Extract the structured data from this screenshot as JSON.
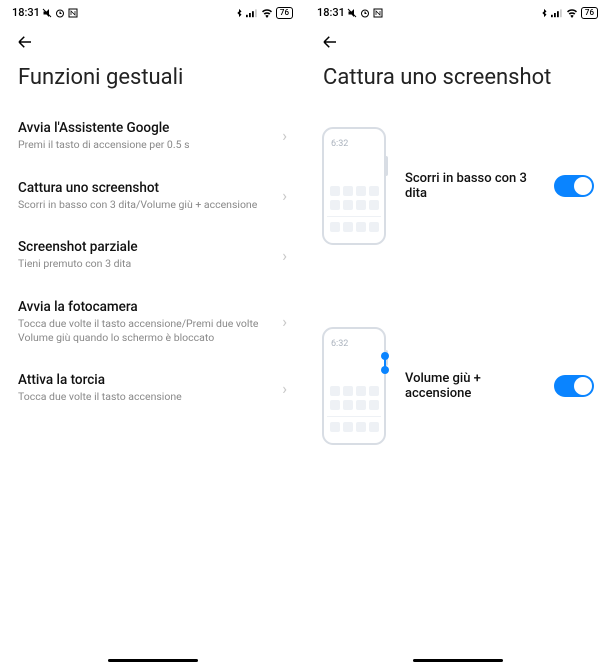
{
  "statusbar": {
    "time": "18:31",
    "battery": "76"
  },
  "left": {
    "title": "Funzioni gestuali",
    "items": [
      {
        "title": "Avvia l'Assistente Google",
        "sub": "Premi il tasto di accensione per 0.5 s"
      },
      {
        "title": "Cattura uno screenshot",
        "sub": "Scorri in basso con 3 dita/Volume giù + accensione"
      },
      {
        "title": "Screenshot parziale",
        "sub": "Tieni premuto con 3 dita"
      },
      {
        "title": "Avvia la fotocamera",
        "sub": "Tocca due volte il tasto accensione/Premi due volte Volume giù quando lo schermo è bloccato"
      },
      {
        "title": "Attiva la torcia",
        "sub": "Tocca due volte il tasto accensione"
      }
    ]
  },
  "right": {
    "title": "Cattura uno screenshot",
    "options": [
      {
        "label": "Scorri in basso con 3 dita",
        "enabled": true,
        "illustration": "swipe"
      },
      {
        "label": "Volume giù + accensione",
        "enabled": true,
        "illustration": "buttons"
      }
    ],
    "mock_time": "6:32"
  }
}
